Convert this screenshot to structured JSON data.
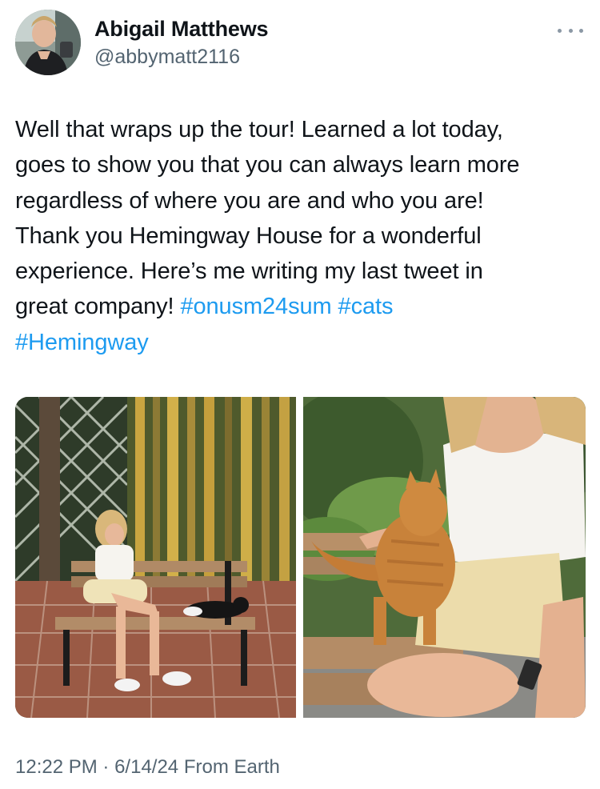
{
  "user": {
    "display_name": "Abigail Matthews",
    "handle": "@abbymatt2116",
    "avatar_icon": "avatar-photo"
  },
  "more_icon": "ellipsis-icon",
  "tweet": {
    "lines": [
      {
        "text": "Well that wraps up the tour! Learned a lot today,"
      },
      {
        "text": "goes to show you that you can always learn more"
      },
      {
        "text": "regardless of where you are and who you are!"
      },
      {
        "text": "Thank you Hemingway House for a wonderful"
      },
      {
        "text": "experience. Here’s me writing my last tweet in"
      },
      {
        "text": "great company! ",
        "tags": [
          "#onusm24sum",
          "#cats"
        ]
      },
      {
        "text": "",
        "tags": [
          "#Hemingway"
        ]
      }
    ]
  },
  "media": [
    {
      "description_icon": "photo-bench-bamboo"
    },
    {
      "description_icon": "photo-orange-cat"
    }
  ],
  "meta": {
    "time": "12:22 PM",
    "separator": "·",
    "date": "6/14/24",
    "source": "From Earth"
  },
  "colors": {
    "hashtag": "#1d9bf0",
    "secondary_text": "#536471",
    "primary_text": "#0f1419"
  }
}
